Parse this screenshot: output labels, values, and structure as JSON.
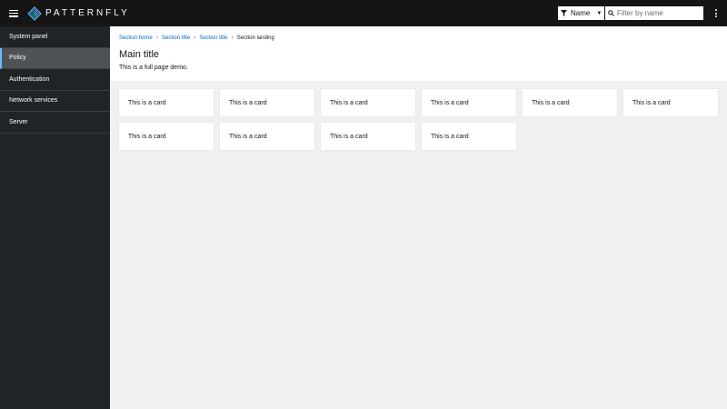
{
  "masthead": {
    "brand": "PATTERNFLY",
    "filter_label": "Name",
    "search_placeholder": "Filter by name"
  },
  "sidebar": {
    "items": [
      {
        "label": "System panel",
        "active": false
      },
      {
        "label": "Policy",
        "active": true
      },
      {
        "label": "Authentication",
        "active": false
      },
      {
        "label": "Network services",
        "active": false
      },
      {
        "label": "Server",
        "active": false
      }
    ]
  },
  "breadcrumb": [
    "Section home",
    "Section title",
    "Section title",
    "Section landing"
  ],
  "page": {
    "title": "Main title",
    "description": "This is a full page demo."
  },
  "cards": [
    "This is a card",
    "This is a card",
    "This is a card",
    "This is a card",
    "This is a card",
    "This is a card",
    "This is a card",
    "This is a card",
    "This is a card",
    "This is a card"
  ],
  "colors": {
    "masthead_bg": "#151515",
    "sidebar_bg": "#212427",
    "active_indicator": "#73bcf7",
    "link": "#0066cc"
  }
}
